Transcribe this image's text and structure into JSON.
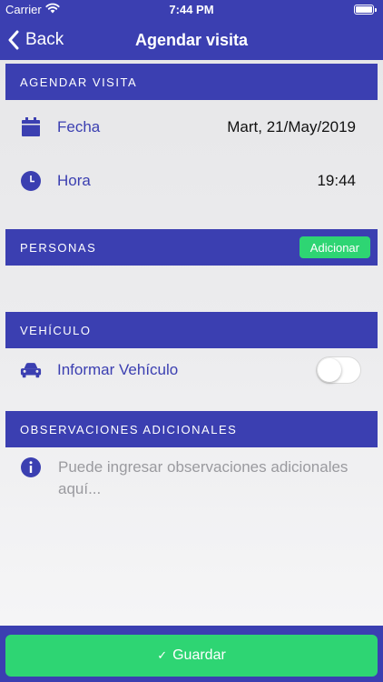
{
  "status_bar": {
    "carrier": "Carrier",
    "time": "7:44 PM"
  },
  "nav": {
    "back_label": "Back",
    "title": "Agendar visita"
  },
  "sections": {
    "agendar": "AGENDAR VISITA",
    "personas": "PERSONAS",
    "vehiculo": "VEHÍCULO",
    "observaciones": "OBSERVACIONES ADICIONALES"
  },
  "fecha": {
    "label": "Fecha",
    "value": "Mart, 21/May/2019"
  },
  "hora": {
    "label": "Hora",
    "value": "19:44"
  },
  "personas": {
    "add_label": "Adicionar"
  },
  "vehiculo": {
    "label": "Informar Vehículo",
    "toggle_on": false
  },
  "observaciones": {
    "placeholder": "Puede ingresar observaciones adicionales aquí..."
  },
  "footer": {
    "save_label": "Guardar"
  },
  "colors": {
    "primary": "#3b3fb1",
    "accent": "#2ed573"
  }
}
